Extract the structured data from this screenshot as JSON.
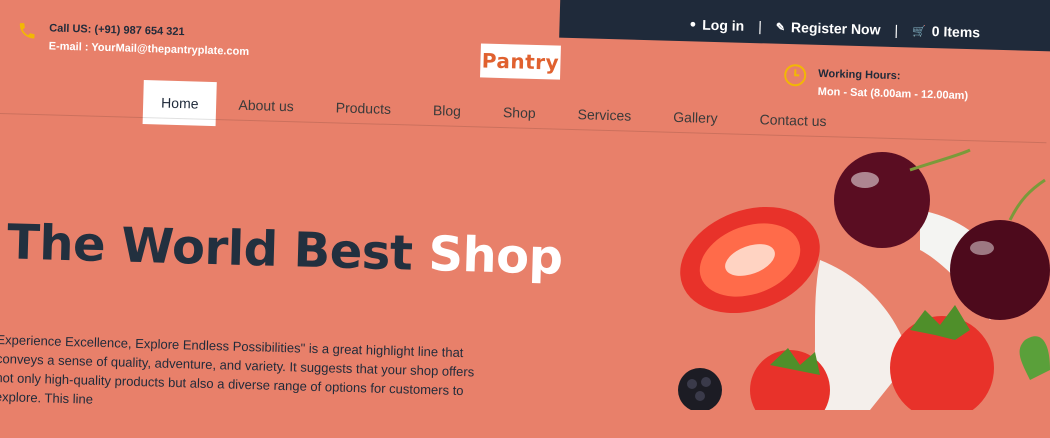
{
  "topbar": {
    "login_label": "Log in",
    "register_label": "Register Now",
    "cart_label": "0 Items",
    "separator": "|"
  },
  "contact": {
    "phone": "Call US: (+91) 987 654 321",
    "email": "E-mail : YourMail@thepantryplate.com"
  },
  "logo": {
    "text": "Pantry"
  },
  "hours": {
    "title": "Working Hours:",
    "value": "Mon - Sat (8.00am - 12.00am)"
  },
  "nav": {
    "items": [
      {
        "label": "Home",
        "active": true
      },
      {
        "label": "About us"
      },
      {
        "label": "Products"
      },
      {
        "label": "Blog"
      },
      {
        "label": "Shop"
      },
      {
        "label": "Services"
      },
      {
        "label": "Gallery"
      },
      {
        "label": "Contact us"
      }
    ]
  },
  "hero": {
    "title_main": "The World Best",
    "title_accent": "Shop",
    "text": "Experience Excellence, Explore Endless Possibilities\" is a great highlight line that conveys a sense of quality, adventure, and variety. It suggests that your shop offers not only high-quality products but also a diverse range of options for customers to explore. This line"
  },
  "colors": {
    "background": "#e8806a",
    "dark": "#1f2a3a",
    "accent": "#f2b705"
  }
}
